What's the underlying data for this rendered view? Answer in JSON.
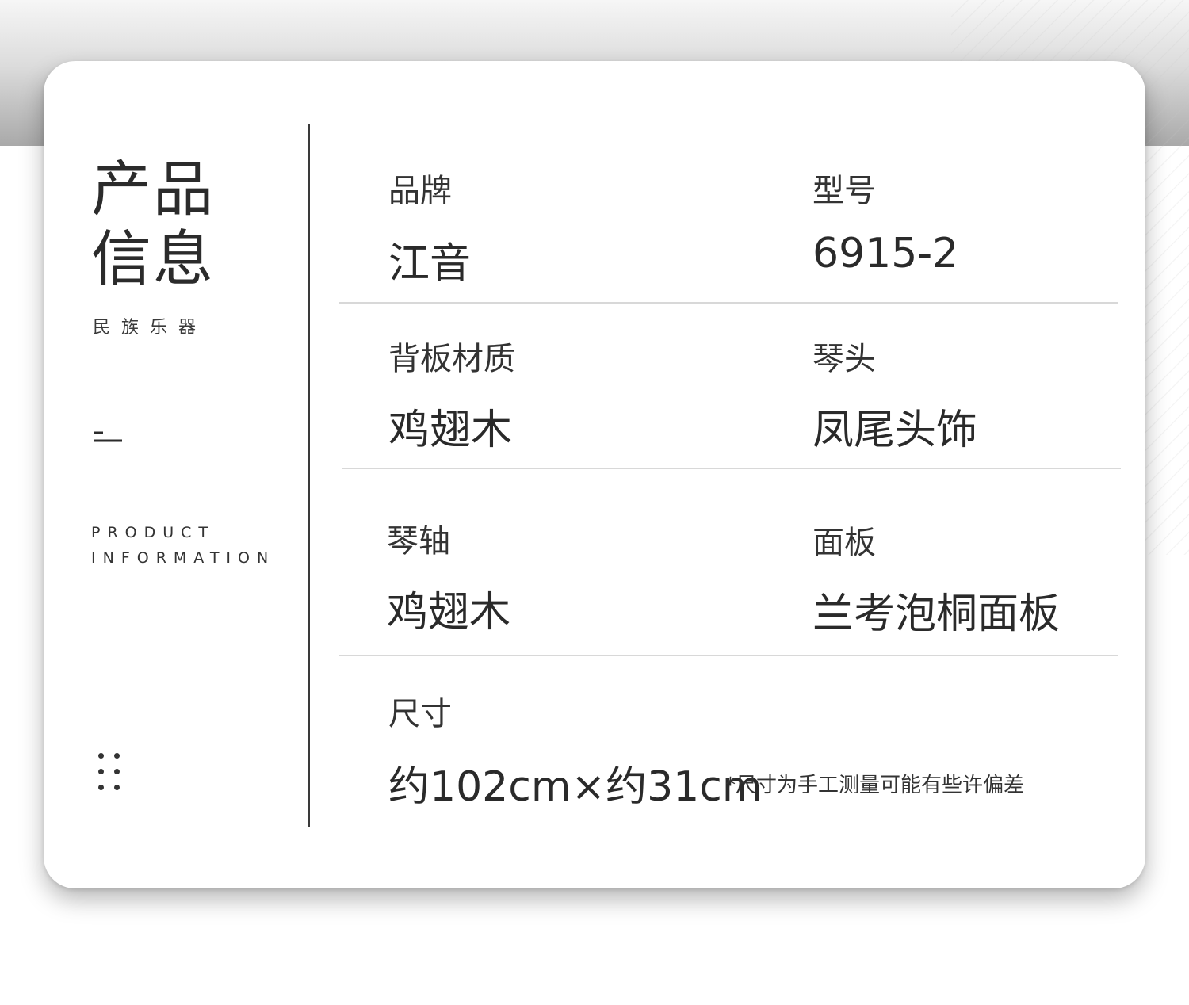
{
  "card": {
    "title": "产品信息",
    "subtitle": "民族乐器",
    "en_line1": "PRODUCT",
    "en_line2": "INFORMATION",
    "dash_icon": "dash-mark-icon",
    "dots_icon": "dots-grid-icon"
  },
  "specs": [
    {
      "label": "品牌",
      "value": "江音"
    },
    {
      "label": "型号",
      "value": "6915-2"
    },
    {
      "label": "背板材质",
      "value": "鸡翅木"
    },
    {
      "label": "琴头",
      "value": "凤尾头饰"
    },
    {
      "label": "琴轴",
      "value": "鸡翅木"
    },
    {
      "label": "面板",
      "value": "兰考泡桐面板"
    }
  ],
  "size": {
    "label": "尺寸",
    "value": "约102cm×约31cm",
    "note": "*尺寸为手工测量可能有些许偏差"
  },
  "colors": {
    "text": "#2a2a2a",
    "divider": "#d8d8d8",
    "vertical_rule": "#3a3a3a",
    "card_bg": "#ffffff"
  }
}
